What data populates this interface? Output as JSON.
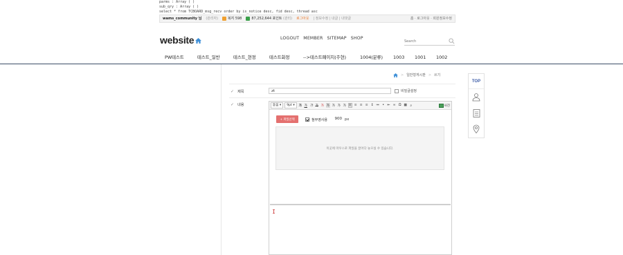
{
  "debug": {
    "line1": "parms : Array ( )",
    "line2": "sub_qry : Array ( )",
    "line3": "select * from TCBOARD_msg_recv order by is_notice desc, fid desc, thread asc"
  },
  "userbar": {
    "username": "wams_community 님",
    "member_type": "(관리자)",
    "points": "복지 598",
    "money": "87,252,644 포인트",
    "money_grade": "(관리)",
    "logout": "로그아웃",
    "links": "| 정보수정 | 내글 | 내댓글",
    "right_text": "홈 · 로그아웃 · 회원정보수정",
    "colors": {
      "points": "#f0a030",
      "money": "#3aa04a",
      "logout": "#e8782c"
    }
  },
  "header": {
    "logo": "website",
    "nav": [
      "LOGOUT",
      "MEMBER",
      "SITEMAP",
      "SHOP"
    ],
    "search_placeholder": "Search"
  },
  "mainnav": {
    "items": [
      "PW테스트",
      "테스트_일반",
      "테스트_현정",
      "테스트화정",
      "-->테스트페이지(주현)",
      "1004(분류)",
      "1003",
      "1001",
      "1002"
    ]
  },
  "breadcrumb": {
    "items": [
      "일반형게시판",
      "쓰기"
    ]
  },
  "form": {
    "title_label": "제목",
    "title_value": "zt",
    "secret_label": "비밀글설정",
    "content_label": "내용"
  },
  "editor": {
    "font_select": "돋움",
    "size_select": "9pt",
    "tool_labels": [
      "가",
      "가",
      "가",
      "가",
      "가",
      "가",
      "가",
      "가",
      "가"
    ],
    "image_label": "사진",
    "upload_button": "+ 파일선택",
    "resize_label": "첨부영사용",
    "resize_value": "900",
    "resize_unit": "px",
    "dropzone_text": "이곳에 마우스로 파일을 끌어다 놓으실 수 있습니다."
  },
  "sidebar": {
    "top": "TOP",
    "icons": [
      "person-icon",
      "clipboard-icon",
      "location-pin-icon"
    ]
  },
  "colors": {
    "nav_line": "#3a4b66",
    "upload_btn": "#e4706f",
    "top_text": "#3a5aa6"
  }
}
